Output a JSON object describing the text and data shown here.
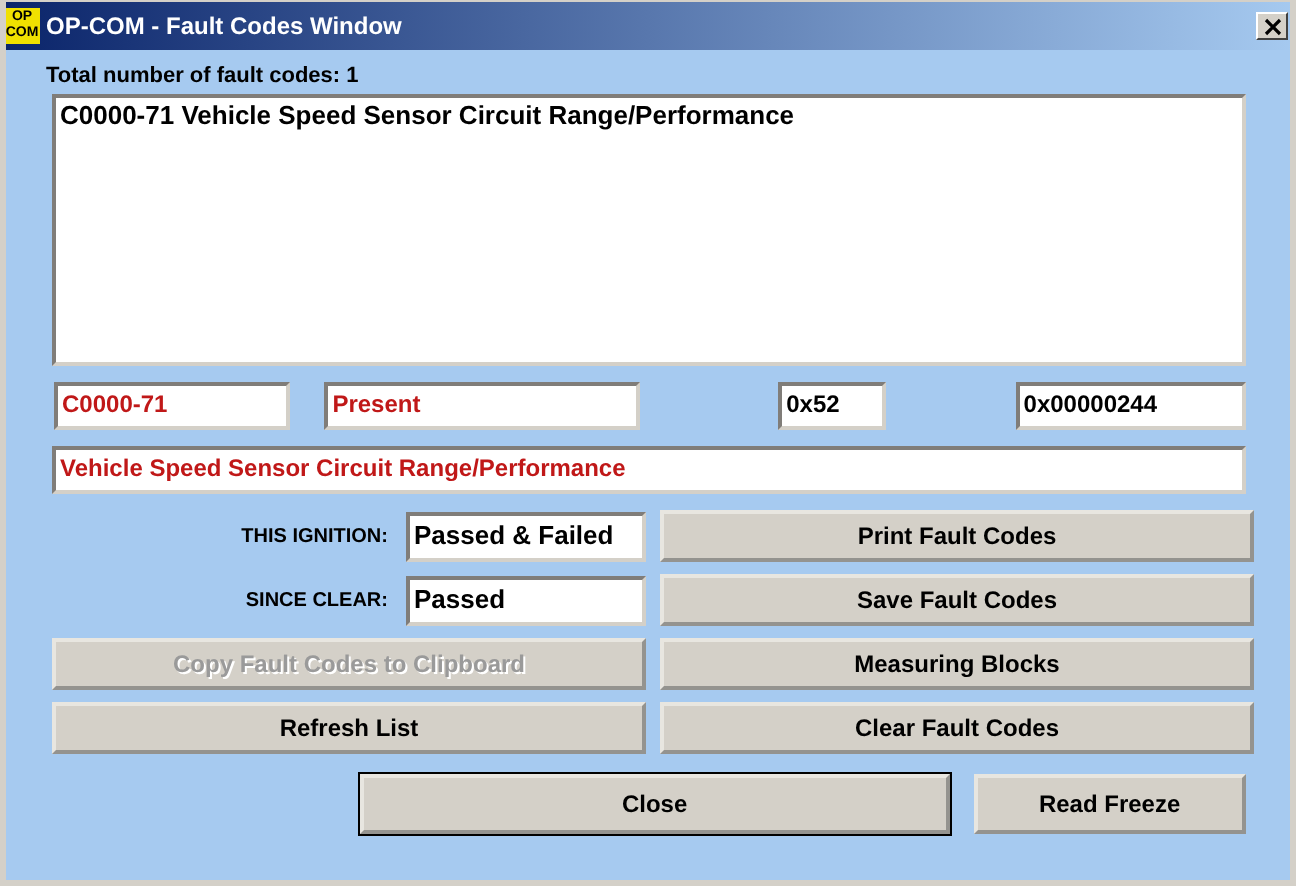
{
  "window": {
    "title": "OP-COM - Fault Codes Window",
    "icon_lines": [
      "OP",
      "COM"
    ]
  },
  "total_label": "Total number of fault codes:  1",
  "fault_list": [
    {
      "text": "C0000-71 Vehicle Speed Sensor Circuit Range/Performance",
      "selected": false
    }
  ],
  "detail_fields": [
    {
      "value": "C0000-71",
      "alert": true
    },
    {
      "value": "Present",
      "alert": true
    },
    {
      "value": "0x52",
      "alert": false
    },
    {
      "value": "0x00000244",
      "alert": false
    }
  ],
  "description": {
    "value": "Vehicle Speed Sensor Circuit Range/Performance",
    "alert": true
  },
  "status": [
    {
      "label": "THIS IGNITION:",
      "value": "Passed & Failed"
    },
    {
      "label": "SINCE CLEAR:",
      "value": "Passed"
    }
  ],
  "left_buttons": [
    {
      "label": "Copy Fault Codes to Clipboard",
      "disabled": true
    },
    {
      "label": "Refresh List",
      "disabled": false
    }
  ],
  "right_buttons": [
    {
      "label": "Print Fault Codes",
      "disabled": false
    },
    {
      "label": "Save Fault Codes",
      "disabled": false
    },
    {
      "label": "Measuring Blocks",
      "disabled": false
    },
    {
      "label": "Clear Fault Codes",
      "disabled": false
    }
  ],
  "bottom_buttons": [
    {
      "label": "Close",
      "default": true
    },
    {
      "label": "Read Freeze",
      "default": false
    }
  ]
}
